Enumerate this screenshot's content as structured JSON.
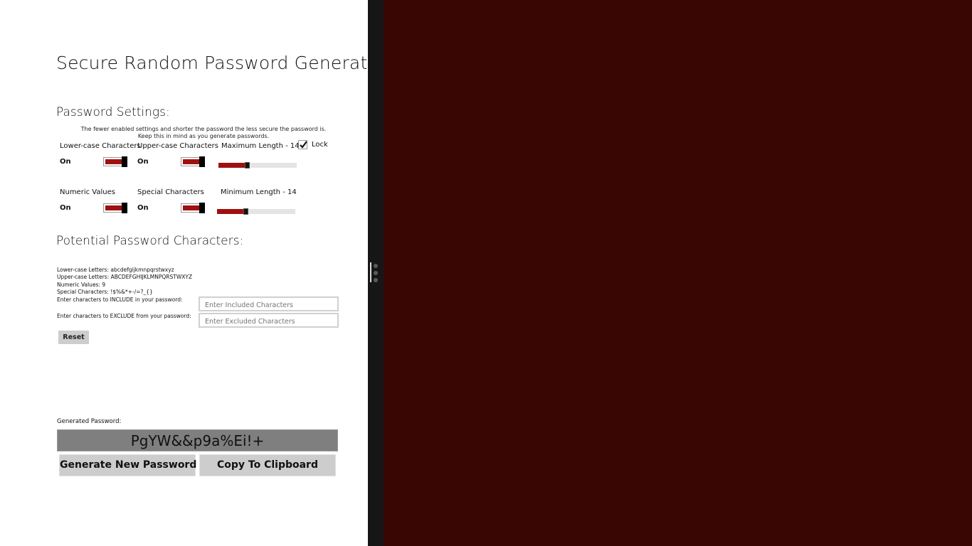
{
  "app": {
    "title": "Secure Random Password Generat..",
    "settings_heading": "Password Settings:",
    "note_line1": "The fewer enabled settings and shorter the password the less secure the password is.",
    "note_line2": "Keep this in mind as you generate passwords."
  },
  "settings": {
    "lowercase": {
      "label": "Lower-case Characters",
      "state": "On",
      "enabled": true
    },
    "uppercase": {
      "label": "Upper-case Characters",
      "state": "On",
      "enabled": true
    },
    "numeric": {
      "label": "Numeric Values",
      "state": "On",
      "enabled": true
    },
    "special": {
      "label": "Special Characters",
      "state": "On",
      "enabled": true
    },
    "max_length": {
      "label": "Maximum Length - 14",
      "value": 14,
      "fraction": 0.36
    },
    "min_length": {
      "label": "Minimum Length - 14",
      "value": 14,
      "fraction": 0.36
    },
    "lock": {
      "label": "Lock",
      "checked": true
    }
  },
  "characters": {
    "heading": "Potential Password Characters:",
    "lowercase": "Lower-case Letters: abcdefgijkmnpqrstwxyz",
    "uppercase": "Upper-case Letters: ABCDEFGHIJKLMNPQRSTWXYZ",
    "numeric": "Numeric Values: 9",
    "special": "Special Characters: !$%&*+-/=?_{}",
    "include_label": "Enter characters to INCLUDE in your password:",
    "exclude_label": "Enter characters to EXCLUDE from your password:",
    "include_placeholder": "Enter Included Characters",
    "exclude_placeholder": "Enter Excluded Characters",
    "include_value": "",
    "exclude_value": "",
    "reset_label": "Reset"
  },
  "output": {
    "label": "Generated Password:",
    "password": "PgYW&&p9a%Ei!+",
    "generate_label": "Generate New Password",
    "copy_label": "Copy To Clipboard"
  },
  "colors": {
    "accent": "#a01010",
    "background_right": "#3a0603",
    "splitter": "#161616"
  }
}
